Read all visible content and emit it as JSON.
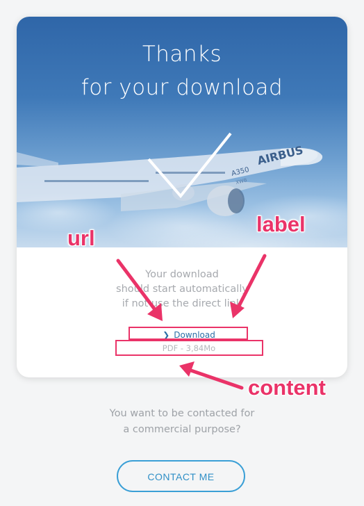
{
  "hero": {
    "title_line1": "Thanks",
    "title_line2": "for your download",
    "aircraft_livery_text": "AIRBUS",
    "aircraft_model_text": "A350",
    "aircraft_model_tail": "XWB"
  },
  "message": {
    "line1": "Your download",
    "line2": "should start automatically",
    "line3": "if not use the direct link"
  },
  "download": {
    "label": "Download",
    "chevron_icon": "chevron-right-icon",
    "file_info": "PDF - 3,84Mo"
  },
  "annotations": {
    "url": "url",
    "label": "label",
    "content": "content",
    "color": "#ea3368"
  },
  "contact": {
    "prompt_line1": "You want to be contacted for",
    "prompt_line2": "a commercial purpose?",
    "button_label": "CONTACT ME"
  },
  "colors": {
    "accent": "#3a9fd6",
    "link": "#2a6ea6",
    "hero_overlay": "#2f66a8"
  }
}
